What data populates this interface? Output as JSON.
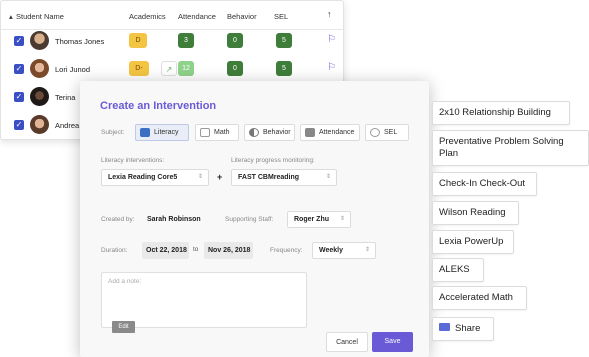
{
  "table": {
    "headers": {
      "student": "Student Name",
      "academics": "Academics",
      "attendance": "Attendance",
      "behavior": "Behavior",
      "sel": "SEL",
      "sort": "↑"
    },
    "rows": [
      {
        "name": "Thomas Jones",
        "academics": "D",
        "attendance": "3",
        "behavior": "0",
        "sel": "5"
      },
      {
        "name": "Lori Junod",
        "academics": "D-",
        "attendance": "12",
        "behavior": "0",
        "sel": "5"
      },
      {
        "name": "Terina",
        "academics": "",
        "attendance": "",
        "behavior": "",
        "sel": ""
      },
      {
        "name": "Andrea",
        "academics": "",
        "attendance": "",
        "behavior": "",
        "sel": ""
      }
    ]
  },
  "modal": {
    "title": "Create an Intervention",
    "subject_label": "Subject:",
    "subjects": [
      "Literacy",
      "Math",
      "Behavior",
      "Attendance",
      "SEL"
    ],
    "interventions_label": "Literacy interventions:",
    "interventions_value": "Lexia Reading Core5",
    "monitoring_label": "Literacy progress monitoring:",
    "monitoring_value": "FAST CBMreading",
    "plus": "+",
    "created_by_label": "Created by:",
    "created_by_value": "Sarah Robinson",
    "staff_label": "Supporting Staff:",
    "staff_value": "Roger Zhu",
    "duration_label": "Duration:",
    "start_date": "Oct 22, 2018",
    "to": "to",
    "end_date": "Nov 26, 2018",
    "frequency_label": "Frequency:",
    "frequency_value": "Weekly",
    "note_placeholder": "Add a note:",
    "edit": "Edit",
    "cancel": "Cancel",
    "save": "Save"
  },
  "tags": [
    "2x10 Relationship Building",
    "Preventative Problem Solving Plan",
    "Check-In Check-Out",
    "Wilson Reading",
    "Lexia PowerUp",
    "ALEKS",
    "Accelerated Math",
    "Share"
  ],
  "colors": {
    "accent": "#6a5ad6",
    "checkbox": "#3a4fc4",
    "grade_yellow": "#f4c542",
    "badge_green": "#3f7d3a"
  }
}
